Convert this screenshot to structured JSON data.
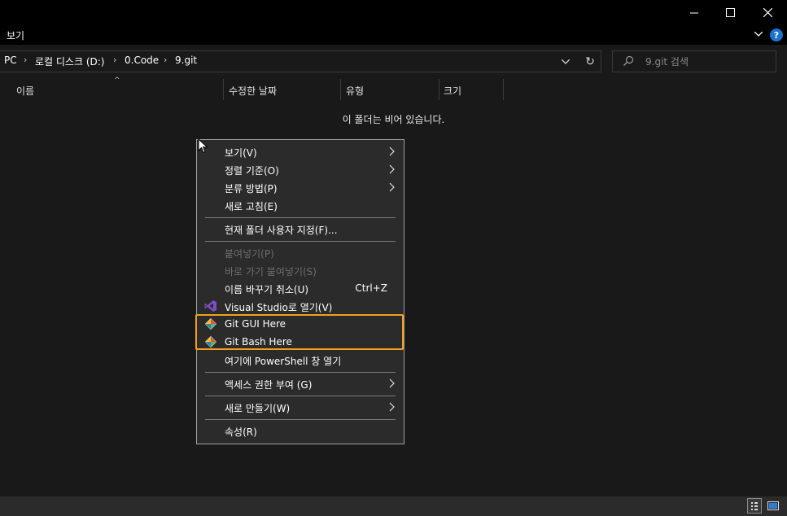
{
  "window": {
    "minimize_icon": "minimize-icon",
    "maximize_icon": "maximize-icon",
    "close_icon": "close-icon"
  },
  "ribbon": {
    "tab_view": "보기",
    "expand_icon": "chevron-down-icon",
    "help_icon_glyph": "?"
  },
  "address": {
    "crumbs": [
      "PC",
      "로컬 디스크 (D:)",
      "0.Code",
      "9.git"
    ],
    "separator": "›",
    "dropdown_icon": "chevron-down-icon",
    "refresh_glyph": "↻"
  },
  "search": {
    "placeholder": "9.git 검색",
    "icon": "search-icon"
  },
  "columns": {
    "name": "이름",
    "date_modified": "수정한 날짜",
    "type": "유형",
    "size": "크기",
    "sort_glyph": "^"
  },
  "content": {
    "empty_message": "이 폴더는 비어 있습니다."
  },
  "context_menu": {
    "items": [
      {
        "label": "보기(V)",
        "submenu": true
      },
      {
        "label": "정렬 기준(O)",
        "submenu": true
      },
      {
        "label": "분류 방법(P)",
        "submenu": true
      },
      {
        "label": "새로 고침(E)"
      },
      {
        "label": "현재 폴더 사용자 지정(F)..."
      },
      {
        "label": "붙여넣기(P)",
        "disabled": true
      },
      {
        "label": "바로 가기 붙여넣기(S)",
        "disabled": true
      },
      {
        "label": "이름 바꾸기 취소(U)",
        "shortcut": "Ctrl+Z"
      },
      {
        "label": "Visual Studio로 열기(V)",
        "icon": "visual-studio-icon"
      },
      {
        "label": "Git GUI Here",
        "icon": "git-gui-icon"
      },
      {
        "label": "Git Bash Here",
        "icon": "git-bash-icon"
      },
      {
        "label": "여기에 PowerShell 창 열기"
      },
      {
        "label": "액세스 권한 부여 (G)",
        "submenu": true
      },
      {
        "label": "새로 만들기(W)",
        "submenu": true
      },
      {
        "label": "속성(R)"
      }
    ],
    "highlight_color": "#f3a01c"
  },
  "statusbar": {
    "details_view_icon": "details-view-icon",
    "large_icons_view_icon": "large-icons-view-icon"
  }
}
